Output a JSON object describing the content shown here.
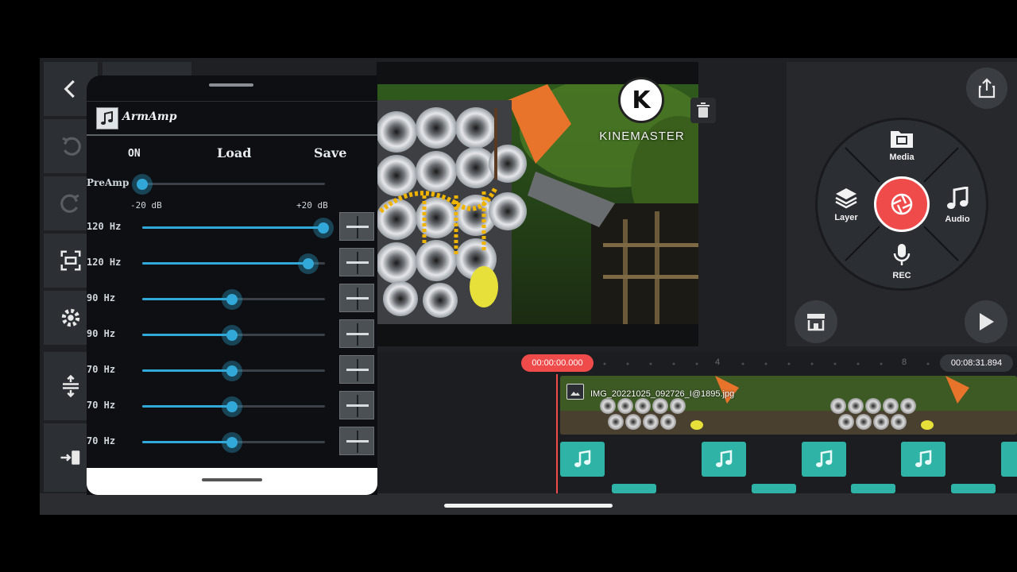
{
  "armamp": {
    "app_name": "ArmAmp",
    "on_label": "ON",
    "load_label": "Load",
    "save_label": "Save",
    "preamp_label": "PreAmp",
    "preamp_level": 0.0,
    "range_min": "-20  dB",
    "range_max": "+20  dB",
    "bands": [
      {
        "label": "120  Hz",
        "level": 0.99
      },
      {
        "label": "120  Hz",
        "level": 0.91
      },
      {
        "label": "90  Hz",
        "level": 0.49
      },
      {
        "label": "90  Hz",
        "level": 0.49
      },
      {
        "label": "70  Hz",
        "level": 0.49
      },
      {
        "label": "70  Hz",
        "level": 0.49
      },
      {
        "label": "70  Hz",
        "level": 0.49
      }
    ]
  },
  "watermark": {
    "logo_letter": "K",
    "text": "KINEMASTER"
  },
  "media_wheel": {
    "media_label": "Media",
    "layer_label": "Layer",
    "audio_label": "Audio",
    "rec_label": "REC"
  },
  "timeline": {
    "current_time": "00:00:00.000",
    "total_time": "00:08:31.894",
    "ruler_marks": [
      "4",
      "8"
    ],
    "clip_name": "IMG_20221025_092726_I@1895.jpg"
  },
  "colors": {
    "accent_red": "#f04b4b",
    "accent_blue": "#32a8d8",
    "audio_clip": "#2fb3a6"
  }
}
